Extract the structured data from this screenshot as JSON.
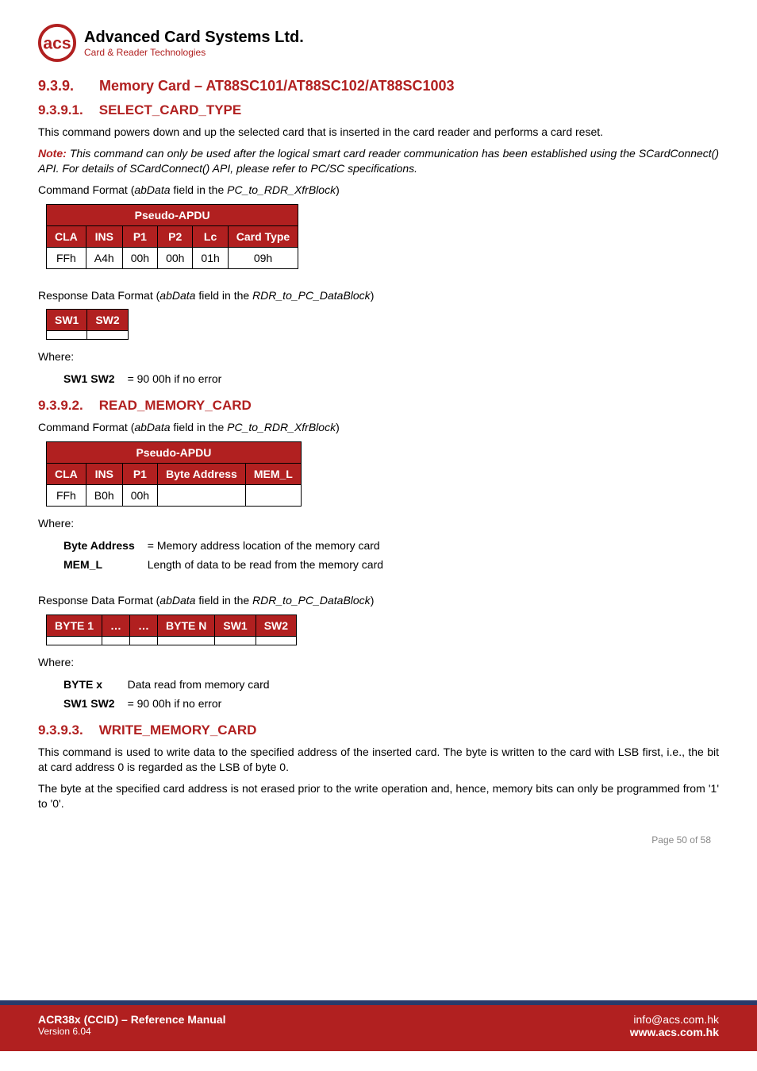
{
  "header": {
    "company": "Advanced Card Systems Ltd.",
    "subtitle": "Card & Reader Technologies"
  },
  "sections": {
    "s939": {
      "num": "9.3.9.",
      "title": "Memory Card – AT88SC101/AT88SC102/AT88SC1003"
    },
    "s9391": {
      "num": "9.3.9.1.",
      "title": "SELECT_CARD_TYPE"
    },
    "s9392": {
      "num": "9.3.9.2.",
      "title": "READ_MEMORY_CARD"
    },
    "s9393": {
      "num": "9.3.9.3.",
      "title": "WRITE_MEMORY_CARD"
    }
  },
  "text": {
    "select_desc": "This command powers down and up the selected card that is inserted in the card reader and performs a card reset.",
    "note_lead": "Note:",
    "note_body": " This command can only be used after the logical smart card reader communication has been established using the SCardConnect() API. For details of SCardConnect() API, please refer to PC/SC specifications.",
    "cmd_format_prefix": "Command Format (",
    "cmd_format_mid": "abData",
    "cmd_format_suffix1": " field in the ",
    "cmd_format_block1": "PC_to_RDR_XfrBlock",
    "cmd_format_end": ")",
    "resp_format_prefix": "Response Data Format (",
    "resp_format_block": "RDR_to_PC_DataBlock",
    "where": "Where:",
    "sw1sw2_label": "SW1 SW2",
    "sw1sw2_val": "= 90 00h if no error",
    "byte_addr_label": "Byte Address",
    "byte_addr_val": "= Memory address location of the memory card",
    "mem_l_label": "MEM_L",
    "mem_l_val": "Length of data to be read from the memory card",
    "byte_x_label": "BYTE x",
    "byte_x_val": "Data read from memory card",
    "write_desc1": "This command is used to write data to the specified address of the inserted card. The byte is written to the card with LSB first, i.e., the bit at card address 0 is regarded as the LSB of byte 0.",
    "write_desc2": "The byte at the specified card address is not erased prior to the write operation and, hence, memory bits can only be programmed from '1' to '0'."
  },
  "tables": {
    "pseudo1": {
      "title": "Pseudo-APDU",
      "headers": [
        "CLA",
        "INS",
        "P1",
        "P2",
        "Lc",
        "Card Type"
      ],
      "row": [
        "FFh",
        "A4h",
        "00h",
        "00h",
        "01h",
        "09h"
      ]
    },
    "resp1": {
      "headers": [
        "SW1",
        "SW2"
      ],
      "row": [
        "",
        ""
      ]
    },
    "pseudo2": {
      "title": "Pseudo-APDU",
      "headers": [
        "CLA",
        "INS",
        "P1",
        "Byte Address",
        "MEM_L"
      ],
      "row": [
        "FFh",
        "B0h",
        "00h",
        "",
        ""
      ]
    },
    "resp2": {
      "headers": [
        "BYTE 1",
        "…",
        "…",
        "BYTE N",
        "SW1",
        "SW2"
      ],
      "row": [
        "",
        "",
        "",
        "",
        "",
        ""
      ]
    }
  },
  "page_num": "Page 50 of 58",
  "footer": {
    "doc_title": "ACR38x (CCID) – Reference Manual",
    "version": "Version 6.04",
    "email": "info@acs.com.hk",
    "site": "www.acs.com.hk"
  }
}
